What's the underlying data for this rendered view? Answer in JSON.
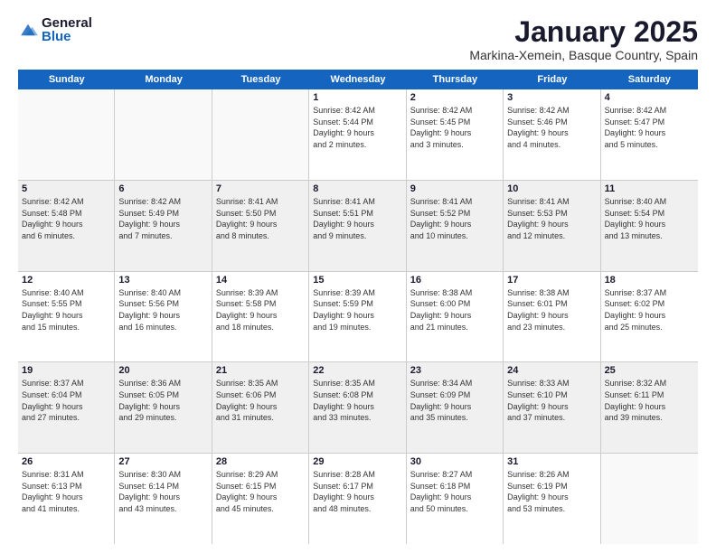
{
  "logo": {
    "general": "General",
    "blue": "Blue"
  },
  "title": "January 2025",
  "subtitle": "Markina-Xemein, Basque Country, Spain",
  "days": [
    "Sunday",
    "Monday",
    "Tuesday",
    "Wednesday",
    "Thursday",
    "Friday",
    "Saturday"
  ],
  "rows": [
    [
      {
        "day": "",
        "empty": true
      },
      {
        "day": "",
        "empty": true
      },
      {
        "day": "",
        "empty": true
      },
      {
        "day": "1",
        "lines": [
          "Sunrise: 8:42 AM",
          "Sunset: 5:44 PM",
          "Daylight: 9 hours",
          "and 2 minutes."
        ]
      },
      {
        "day": "2",
        "lines": [
          "Sunrise: 8:42 AM",
          "Sunset: 5:45 PM",
          "Daylight: 9 hours",
          "and 3 minutes."
        ]
      },
      {
        "day": "3",
        "lines": [
          "Sunrise: 8:42 AM",
          "Sunset: 5:46 PM",
          "Daylight: 9 hours",
          "and 4 minutes."
        ]
      },
      {
        "day": "4",
        "lines": [
          "Sunrise: 8:42 AM",
          "Sunset: 5:47 PM",
          "Daylight: 9 hours",
          "and 5 minutes."
        ]
      }
    ],
    [
      {
        "day": "5",
        "lines": [
          "Sunrise: 8:42 AM",
          "Sunset: 5:48 PM",
          "Daylight: 9 hours",
          "and 6 minutes."
        ]
      },
      {
        "day": "6",
        "lines": [
          "Sunrise: 8:42 AM",
          "Sunset: 5:49 PM",
          "Daylight: 9 hours",
          "and 7 minutes."
        ]
      },
      {
        "day": "7",
        "lines": [
          "Sunrise: 8:41 AM",
          "Sunset: 5:50 PM",
          "Daylight: 9 hours",
          "and 8 minutes."
        ]
      },
      {
        "day": "8",
        "lines": [
          "Sunrise: 8:41 AM",
          "Sunset: 5:51 PM",
          "Daylight: 9 hours",
          "and 9 minutes."
        ]
      },
      {
        "day": "9",
        "lines": [
          "Sunrise: 8:41 AM",
          "Sunset: 5:52 PM",
          "Daylight: 9 hours",
          "and 10 minutes."
        ]
      },
      {
        "day": "10",
        "lines": [
          "Sunrise: 8:41 AM",
          "Sunset: 5:53 PM",
          "Daylight: 9 hours",
          "and 12 minutes."
        ]
      },
      {
        "day": "11",
        "lines": [
          "Sunrise: 8:40 AM",
          "Sunset: 5:54 PM",
          "Daylight: 9 hours",
          "and 13 minutes."
        ]
      }
    ],
    [
      {
        "day": "12",
        "lines": [
          "Sunrise: 8:40 AM",
          "Sunset: 5:55 PM",
          "Daylight: 9 hours",
          "and 15 minutes."
        ]
      },
      {
        "day": "13",
        "lines": [
          "Sunrise: 8:40 AM",
          "Sunset: 5:56 PM",
          "Daylight: 9 hours",
          "and 16 minutes."
        ]
      },
      {
        "day": "14",
        "lines": [
          "Sunrise: 8:39 AM",
          "Sunset: 5:58 PM",
          "Daylight: 9 hours",
          "and 18 minutes."
        ]
      },
      {
        "day": "15",
        "lines": [
          "Sunrise: 8:39 AM",
          "Sunset: 5:59 PM",
          "Daylight: 9 hours",
          "and 19 minutes."
        ]
      },
      {
        "day": "16",
        "lines": [
          "Sunrise: 8:38 AM",
          "Sunset: 6:00 PM",
          "Daylight: 9 hours",
          "and 21 minutes."
        ]
      },
      {
        "day": "17",
        "lines": [
          "Sunrise: 8:38 AM",
          "Sunset: 6:01 PM",
          "Daylight: 9 hours",
          "and 23 minutes."
        ]
      },
      {
        "day": "18",
        "lines": [
          "Sunrise: 8:37 AM",
          "Sunset: 6:02 PM",
          "Daylight: 9 hours",
          "and 25 minutes."
        ]
      }
    ],
    [
      {
        "day": "19",
        "lines": [
          "Sunrise: 8:37 AM",
          "Sunset: 6:04 PM",
          "Daylight: 9 hours",
          "and 27 minutes."
        ]
      },
      {
        "day": "20",
        "lines": [
          "Sunrise: 8:36 AM",
          "Sunset: 6:05 PM",
          "Daylight: 9 hours",
          "and 29 minutes."
        ]
      },
      {
        "day": "21",
        "lines": [
          "Sunrise: 8:35 AM",
          "Sunset: 6:06 PM",
          "Daylight: 9 hours",
          "and 31 minutes."
        ]
      },
      {
        "day": "22",
        "lines": [
          "Sunrise: 8:35 AM",
          "Sunset: 6:08 PM",
          "Daylight: 9 hours",
          "and 33 minutes."
        ]
      },
      {
        "day": "23",
        "lines": [
          "Sunrise: 8:34 AM",
          "Sunset: 6:09 PM",
          "Daylight: 9 hours",
          "and 35 minutes."
        ]
      },
      {
        "day": "24",
        "lines": [
          "Sunrise: 8:33 AM",
          "Sunset: 6:10 PM",
          "Daylight: 9 hours",
          "and 37 minutes."
        ]
      },
      {
        "day": "25",
        "lines": [
          "Sunrise: 8:32 AM",
          "Sunset: 6:11 PM",
          "Daylight: 9 hours",
          "and 39 minutes."
        ]
      }
    ],
    [
      {
        "day": "26",
        "lines": [
          "Sunrise: 8:31 AM",
          "Sunset: 6:13 PM",
          "Daylight: 9 hours",
          "and 41 minutes."
        ]
      },
      {
        "day": "27",
        "lines": [
          "Sunrise: 8:30 AM",
          "Sunset: 6:14 PM",
          "Daylight: 9 hours",
          "and 43 minutes."
        ]
      },
      {
        "day": "28",
        "lines": [
          "Sunrise: 8:29 AM",
          "Sunset: 6:15 PM",
          "Daylight: 9 hours",
          "and 45 minutes."
        ]
      },
      {
        "day": "29",
        "lines": [
          "Sunrise: 8:28 AM",
          "Sunset: 6:17 PM",
          "Daylight: 9 hours",
          "and 48 minutes."
        ]
      },
      {
        "day": "30",
        "lines": [
          "Sunrise: 8:27 AM",
          "Sunset: 6:18 PM",
          "Daylight: 9 hours",
          "and 50 minutes."
        ]
      },
      {
        "day": "31",
        "lines": [
          "Sunrise: 8:26 AM",
          "Sunset: 6:19 PM",
          "Daylight: 9 hours",
          "and 53 minutes."
        ]
      },
      {
        "day": "",
        "empty": true
      }
    ]
  ]
}
